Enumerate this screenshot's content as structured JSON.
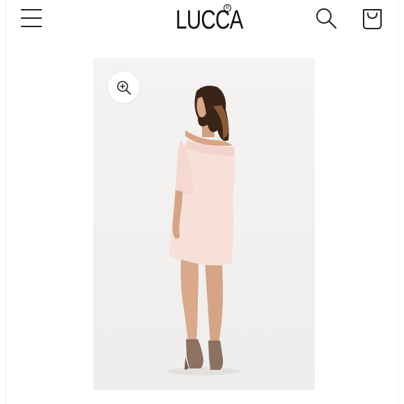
{
  "header": {
    "brand": "LUCCA",
    "brand_mark": "®"
  },
  "icons": {
    "menu": "menu-icon",
    "search": "search-icon",
    "cart": "shopping-bag-icon",
    "zoom": "zoom-in-icon"
  },
  "product": {
    "image": "off-shoulder-blush-dress-photo"
  },
  "colors": {
    "dress": "#f6dcd6",
    "boots": "#8a7262",
    "background": "#f2f1f0"
  }
}
